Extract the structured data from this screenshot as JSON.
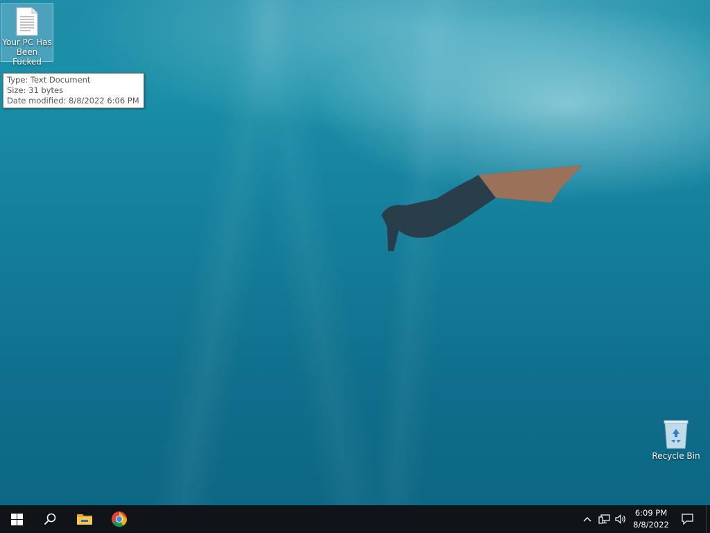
{
  "desktop": {
    "file_icon": {
      "label": "Your PC Has Been Fucked",
      "icon": "text-document-icon"
    },
    "tooltip": {
      "type": "Type: Text Document",
      "size": "Size: 31 bytes",
      "date": "Date modified: 8/8/2022 6:06 PM"
    },
    "recycle_bin": {
      "label": "Recycle Bin",
      "icon": "recycle-bin-icon"
    }
  },
  "taskbar": {
    "start": {
      "icon": "windows-start-icon"
    },
    "search": {
      "icon": "search-icon"
    },
    "pinned": [
      {
        "name": "File Explorer",
        "icon": "folder-icon"
      },
      {
        "name": "Google Chrome",
        "icon": "chrome-icon"
      }
    ],
    "tray": {
      "time": "6:09 PM",
      "date": "8/8/2022",
      "icons": [
        "chevron-up-icon",
        "network-icon",
        "volume-icon",
        "notification-icon"
      ]
    }
  },
  "colors": {
    "taskbar_bg": "#101419",
    "water_top": "#1f8ea8",
    "water_bottom": "#0c6784",
    "explorer_yellow": "#f2c14e"
  }
}
